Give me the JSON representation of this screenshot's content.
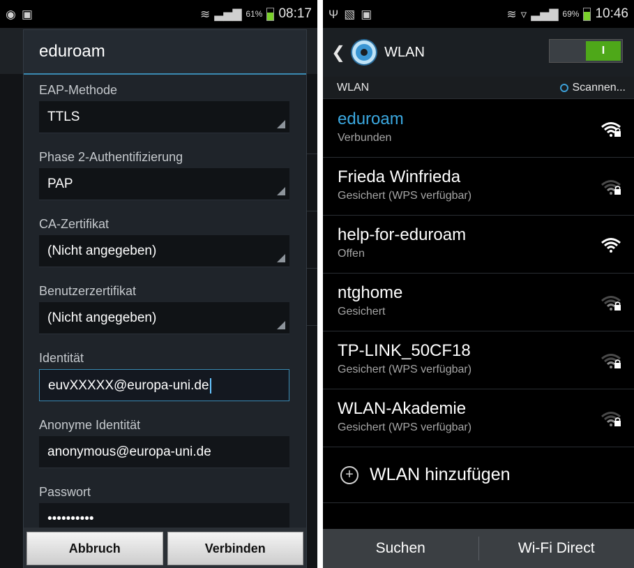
{
  "left_screen": {
    "status": {
      "battery_pct": "61%",
      "time": "08:17"
    },
    "dialog": {
      "title": "eduroam",
      "fields": [
        {
          "label": "EAP-Methode",
          "value": "TTLS"
        },
        {
          "label": "Phase 2-Authentifizierung",
          "value": "PAP"
        },
        {
          "label": "CA-Zertifikat",
          "value": "(Nicht angegeben)"
        },
        {
          "label": "Benutzerzertifikat",
          "value": "(Nicht angegeben)"
        },
        {
          "label": "Identität",
          "value": "euvXXXXX@europa-uni.de"
        },
        {
          "label": "Anonyme Identität",
          "value": "anonymous@europa-uni.de"
        },
        {
          "label": "Passwort",
          "value": "••••••••••"
        }
      ],
      "cancel_label": "Abbruch",
      "connect_label": "Verbinden"
    }
  },
  "right_screen": {
    "status": {
      "battery_pct": "69%",
      "time": "10:46"
    },
    "title": "WLAN",
    "toggle_label": "I",
    "section_title": "WLAN",
    "scan_label": "Scannen...",
    "networks": [
      {
        "name": "eduroam",
        "status": "Verbunden",
        "signal": "full",
        "locked": true,
        "connected": true
      },
      {
        "name": "Frieda Winfrieda",
        "status": "Gesichert (WPS verfügbar)",
        "signal": "weak",
        "locked": true,
        "connected": false
      },
      {
        "name": "help-for-eduroam",
        "status": "Offen",
        "signal": "full",
        "locked": false,
        "connected": false
      },
      {
        "name": "ntghome",
        "status": "Gesichert",
        "signal": "weak",
        "locked": true,
        "connected": false
      },
      {
        "name": "TP-LINK_50CF18",
        "status": "Gesichert (WPS verfügbar)",
        "signal": "weak",
        "locked": true,
        "connected": false
      },
      {
        "name": "WLAN-Akademie",
        "status": "Gesichert (WPS verfügbar)",
        "signal": "weak",
        "locked": true,
        "connected": false
      }
    ],
    "add_label": "WLAN hinzufügen",
    "buttons": {
      "search": "Suchen",
      "wifi_direct": "Wi-Fi Direct"
    },
    "colors": {
      "accent": "#3ba8e0",
      "toggle_on": "#4ea819"
    }
  }
}
